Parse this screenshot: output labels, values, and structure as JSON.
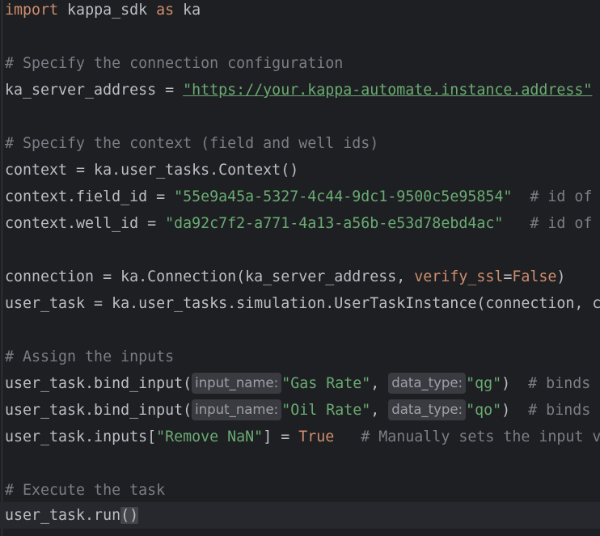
{
  "code": {
    "l1": {
      "kw_import": "import",
      "module": " kappa_sdk ",
      "kw_as": "as",
      "alias": " ka"
    },
    "l3": {
      "comment": "# Specify the connection configuration"
    },
    "l4": {
      "lhs": "ka_server_address = ",
      "url": "\"https://your.kappa-automate.instance.address\""
    },
    "l6": {
      "comment": "# Specify the context (field and well ids)"
    },
    "l7": {
      "code": "context = ka.user_tasks.Context()"
    },
    "l8": {
      "lhs": "context.field_id = ",
      "str": "\"55e9a45a-5327-4c44-9dc1-9500c5e95854\"",
      "comment": "  # id of the field"
    },
    "l9": {
      "lhs": "context.well_id = ",
      "str": "\"da92c7f2-a771-4a13-a56b-e53d78ebd4ac\"",
      "comment": "   # id of the well"
    },
    "l11": {
      "lhs": "connection = ka.Connection(ka_server_address, ",
      "param": "verify_ssl",
      "eq": "=",
      "val": "False",
      "rest": ")"
    },
    "l12": {
      "code": "user_task = ka.user_tasks.simulation.UserTaskInstance(connection, context)"
    },
    "l14": {
      "comment": "# Assign the inputs"
    },
    "l15": {
      "pre": "user_task.bind_input(",
      "hint1": "input_name:",
      "str1": "\"Gas Rate\"",
      "mid": ", ",
      "hint2": "data_type:",
      "str2": "\"qg\"",
      "post": ")  ",
      "comment": "# binds the gas rate input"
    },
    "l16": {
      "pre": "user_task.bind_input(",
      "hint1": "input_name:",
      "str1": "\"Oil Rate\"",
      "mid": ", ",
      "hint2": "data_type:",
      "str2": "\"qo\"",
      "post": ")  ",
      "comment": "# binds the oil rate input"
    },
    "l17": {
      "pre": "user_task.inputs[",
      "str": "\"Remove NaN\"",
      "mid": "] = ",
      "val": "True",
      "comment": "   # Manually sets the input value"
    },
    "l19": {
      "comment": "# Execute the task"
    },
    "l20": {
      "pre": "user_task.run",
      "paren": "()"
    }
  }
}
